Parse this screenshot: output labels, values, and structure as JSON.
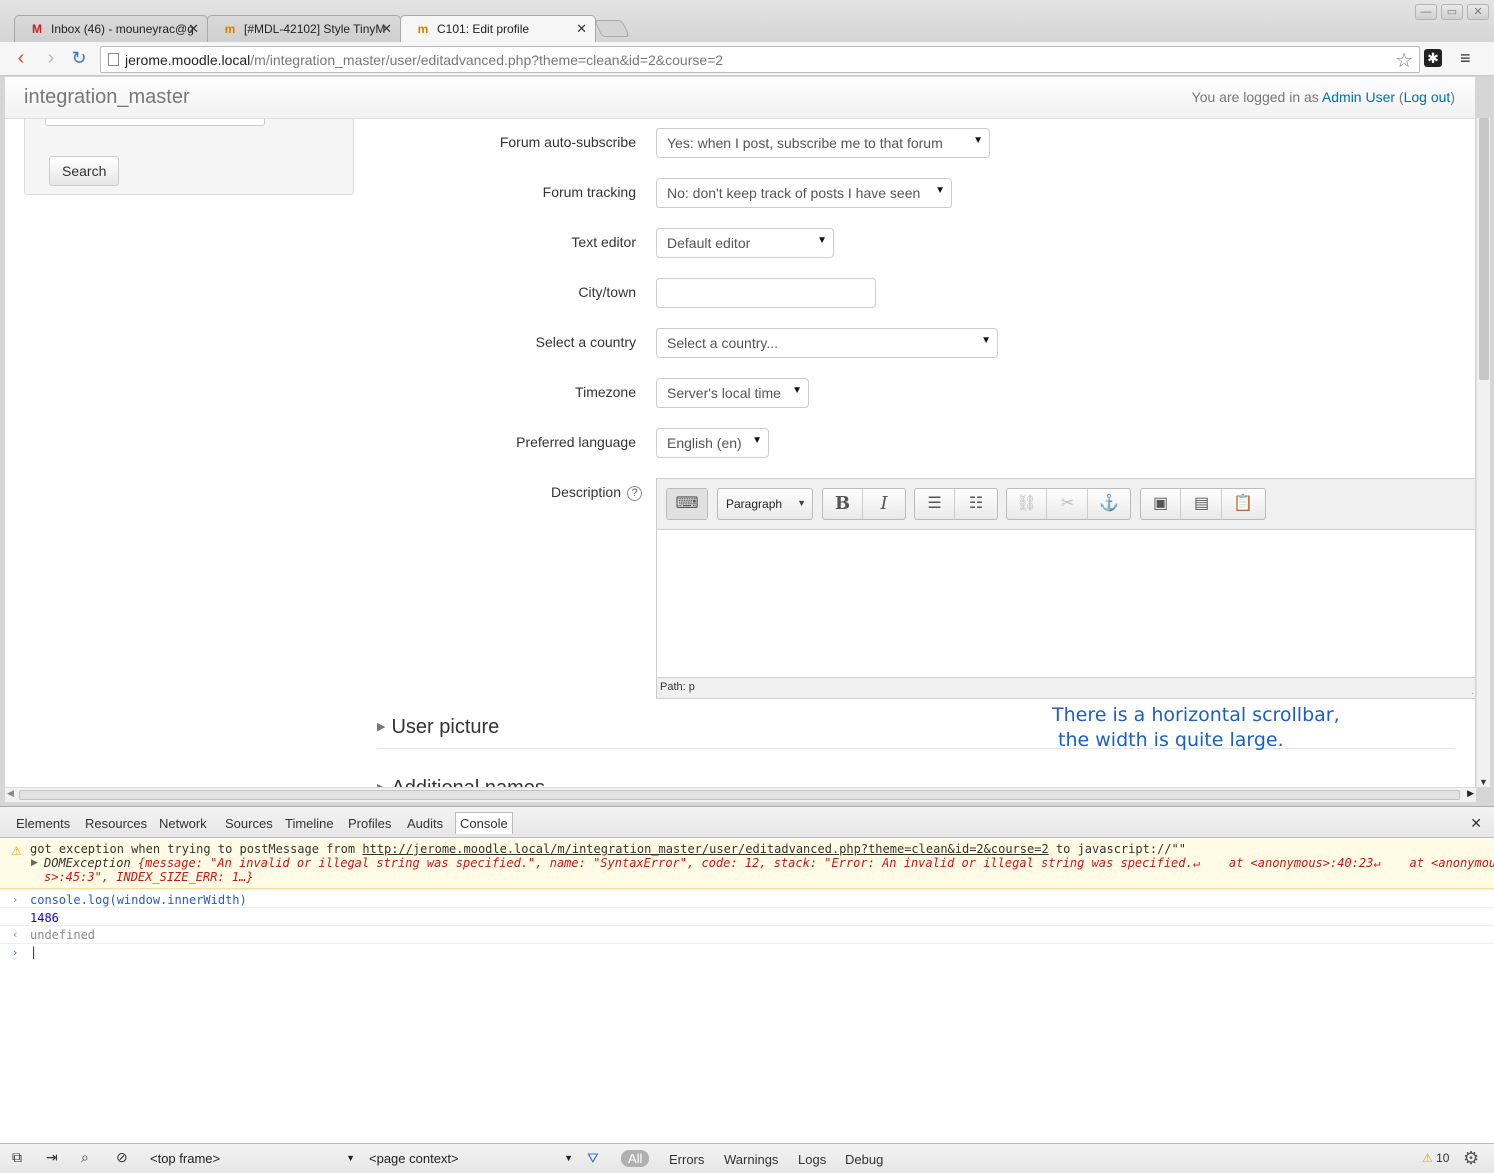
{
  "browser": {
    "tabs": [
      {
        "favicon": "gmail-icon",
        "title": "Inbox (46) - mouneyrac@g",
        "active": false
      },
      {
        "favicon": "moodle-icon",
        "title": "[#MDL-42102] Style TinyM",
        "active": false
      },
      {
        "favicon": "moodle-hat-icon",
        "title": "C101: Edit profile",
        "active": true
      }
    ],
    "url_host": "jerome.moodle.local",
    "url_path": "/m/integration_master/user/editadvanced.php?theme=clean&id=2&course=2"
  },
  "navbar": {
    "brand": "integration_master",
    "logged_in_prefix": "You are logged in as ",
    "user_name": "Admin User",
    "logout_open": " (",
    "logout_label": "Log out",
    "logout_close": ")"
  },
  "sidebar": {
    "search_button": "Search"
  },
  "form": {
    "forum_autosubscribe": {
      "label": "Forum auto-subscribe",
      "value": "Yes: when I post, subscribe me to that forum"
    },
    "forum_tracking": {
      "label": "Forum tracking",
      "value": "No: don't keep track of posts I have seen"
    },
    "text_editor": {
      "label": "Text editor",
      "value": "Default editor"
    },
    "city": {
      "label": "City/town",
      "value": ""
    },
    "country": {
      "label": "Select a country",
      "value": "Select a country..."
    },
    "timezone": {
      "label": "Timezone",
      "value": "Server's local time"
    },
    "language": {
      "label": "Preferred language",
      "value": "English (en)"
    },
    "description": {
      "label": "Description",
      "format_value": "Paragraph",
      "path": "Path: p"
    }
  },
  "sections": {
    "user_picture": "User picture",
    "additional_names": "Additional names"
  },
  "annotation": "There is a horizontal scrollbar,\n the width is quite large.",
  "devtools": {
    "tabs": [
      "Elements",
      "Resources",
      "Network",
      "Sources",
      "Timeline",
      "Profiles",
      "Audits",
      "Console"
    ],
    "active_tab": "Console",
    "console": {
      "warn_prefix": "got exception when trying to postMessage from ",
      "warn_url": "http://jerome.moodle.local/m/integration_master/user/editadvanced.php?theme=clean&id=2&course=2",
      "warn_suffix": " to javascript://\"\"",
      "exception_name": "DOMException",
      "exception_line1": " {message: \"An invalid or illegal string was specified.\", name: \"SyntaxError\", code: 12, stack: \"Error: An invalid or illegal string was specified.↵    at <anonymous>:40:23↵    at <anonymou",
      "exception_line2": "s>:45:3\", INDEX_SIZE_ERR: 1…}",
      "command": "console.log(window.innerWidth)",
      "output": "1486",
      "return_value": "undefined"
    },
    "status": {
      "frame_select": "<top frame>",
      "context_select": "<page context>",
      "filter_all": "All",
      "filters": [
        "Errors",
        "Warnings",
        "Logs",
        "Debug"
      ],
      "warning_count": "10"
    }
  }
}
